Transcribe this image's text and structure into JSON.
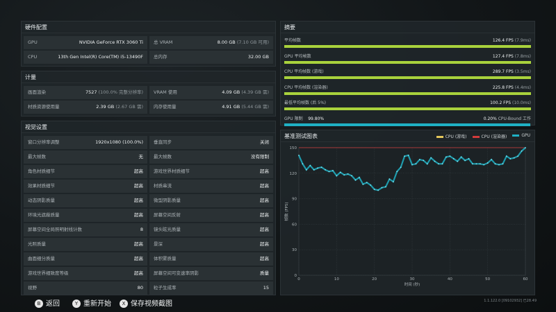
{
  "hardware": {
    "title": "硬件配置",
    "rows": [
      {
        "label": "GPU",
        "value": "NVIDIA GeForce RTX 3060 Ti",
        "label2": "总 VRAM",
        "value2": "8.00 GB",
        "sub2": "(7.10 GB 可用)"
      },
      {
        "label": "CPU",
        "value": "13th Gen Intel(R) Core(TM) i5-13490F",
        "label2": "总内存",
        "value2": "32.00 GB",
        "sub2": ""
      }
    ]
  },
  "metrics": {
    "title": "计量",
    "rows": [
      {
        "label": "画面渲染",
        "value": "7527",
        "sub": "(100.0% 完整分辨率)",
        "label2": "VRAM 使用",
        "value2": "4.09 GB",
        "sub2": "(4.39 GB 需)"
      },
      {
        "label": "材质资源使用量",
        "value": "2.39 GB",
        "sub": "(2.67 GB 需)",
        "label2": "内存使用量",
        "value2": "4.91 GB",
        "sub2": "(5.44 GB 需)"
      }
    ]
  },
  "video": {
    "title": "视觉设置",
    "rows": [
      {
        "l1": "窗口分辨率调整",
        "v1": "1920x1080 (100.0%)",
        "l2": "垂直同步",
        "v2": "关闭"
      },
      {
        "l1": "最大帧数",
        "v1": "无",
        "l2": "最大帧数",
        "v2": "没有限制"
      },
      {
        "l1": "角色材质细节",
        "v1": "超高",
        "l2": "游戏世界材质细节",
        "v2": "超高"
      },
      {
        "l1": "效果材质细节",
        "v1": "超高",
        "l2": "材质串流",
        "v2": "超高"
      },
      {
        "l1": "动态阴影质量",
        "v1": "超高",
        "l2": "微型阴影质量",
        "v2": "超高"
      },
      {
        "l1": "环境光遮蔽质量",
        "v1": "超高",
        "l2": "屏幕空间反射",
        "v2": "超高"
      },
      {
        "l1": "屏幕空间全局照明射线计数",
        "v1": "8",
        "l2": "镜头眩光质量",
        "v2": "超高"
      },
      {
        "l1": "光照质量",
        "v1": "超高",
        "l2": "景深",
        "v2": "超高"
      },
      {
        "l1": "曲面细分质量",
        "v1": "超高",
        "l2": "体积雾质量",
        "v2": "超高"
      },
      {
        "l1": "游戏世界细致度等级",
        "v1": "超高",
        "l2": "屏幕空间可变速率阴影",
        "v2": "质量"
      },
      {
        "l1": "视野",
        "v1": "80",
        "l2": "粒子生成率",
        "v2": "15"
      }
    ]
  },
  "summary": {
    "title": "摘要",
    "rows": [
      {
        "label": "平均帧数",
        "value": "126.4 FPS",
        "sub": "(7.9ms)",
        "fill": 0.999,
        "color": "lime"
      },
      {
        "label": "GPU 平均帧数",
        "value": "127.4 FPS",
        "sub": "(7.8ms)",
        "fill": 0.999,
        "color": "lime"
      },
      {
        "label": "CPU 平均帧数 (游戏)",
        "value": "289.7 FPS",
        "sub": "(3.5ms)",
        "fill": 0.999,
        "color": "lime"
      },
      {
        "label": "CPU 平均帧数 (渲染器)",
        "value": "225.8 FPS",
        "sub": "(4.4ms)",
        "fill": 0.999,
        "color": "lime"
      },
      {
        "label": "最低平均帧数 (后 5%)",
        "value": "100.2 FPS",
        "sub": "(10.0ms)",
        "fill": 0.999,
        "color": "lime"
      }
    ],
    "gpu_limit": {
      "label": "GPU 限制",
      "pct": "99.80%",
      "right_pct": "0.20%",
      "right_label": "CPU-Bound 工作",
      "fill": 0.998
    }
  },
  "chart_title": "基准测试图表",
  "chart_data": {
    "type": "line",
    "title": "基准测试图表",
    "xlabel": "时间 (秒)",
    "ylabel": "帧数 (FPS)",
    "xlim": [
      0,
      60
    ],
    "ylim": [
      0,
      150
    ],
    "xticks": [
      0,
      10,
      20,
      30,
      40,
      50,
      60
    ],
    "yticks": [
      0,
      30,
      60,
      90,
      120,
      150
    ],
    "grid": true,
    "legend": "top-right",
    "series": [
      {
        "name": "CPU (游戏)",
        "color": "#e3c65a",
        "values": []
      },
      {
        "name": "CPU (渲染器)",
        "color": "#d23b3b",
        "values": []
      },
      {
        "name": "GPU",
        "color": "#1fb0c4",
        "x": [
          0,
          1,
          2,
          3,
          4,
          5,
          6,
          7,
          8,
          9,
          10,
          11,
          12,
          13,
          14,
          15,
          16,
          17,
          18,
          19,
          20,
          21,
          22,
          23,
          24,
          25,
          26,
          27,
          28,
          29,
          30,
          31,
          32,
          33,
          34,
          35,
          36,
          37,
          38,
          39,
          40,
          41,
          42,
          43,
          44,
          45,
          46,
          47,
          48,
          49,
          50,
          51,
          52,
          53,
          54,
          55,
          56,
          57,
          58,
          59,
          60
        ],
        "values": [
          141,
          131,
          124,
          129,
          124,
          126,
          127,
          124,
          122,
          123,
          117,
          121,
          118,
          119,
          117,
          112,
          115,
          107,
          109,
          106,
          101,
          100,
          103,
          104,
          113,
          110,
          122,
          127,
          140,
          141,
          130,
          131,
          136,
          135,
          131,
          138,
          134,
          131,
          131,
          139,
          140,
          137,
          134,
          139,
          135,
          137,
          131,
          131,
          131,
          130,
          132,
          136,
          131,
          130,
          131,
          140,
          137,
          138,
          140,
          146,
          150
        ]
      }
    ],
    "ref_line": 150
  },
  "bottom": {
    "back": "返回",
    "restart": "重新开始",
    "save": "保存视频截图"
  },
  "version": "1.1.122.0 [09102932] 已28.49"
}
